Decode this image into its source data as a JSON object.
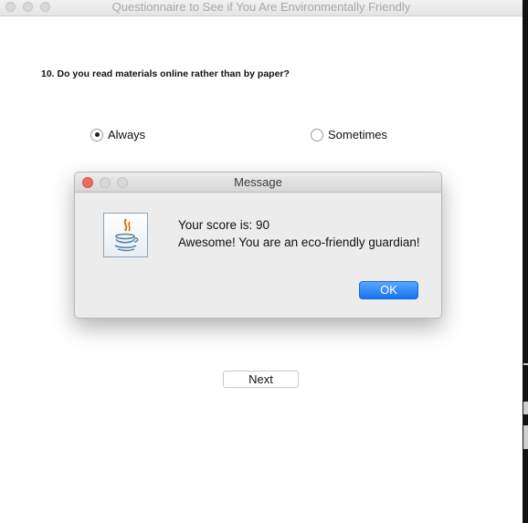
{
  "window": {
    "title": "Questionnaire to See if You Are Environmentally Friendly"
  },
  "question": {
    "text": "10. Do you read materials online rather than by paper?"
  },
  "options": [
    {
      "label": "Always",
      "selected": true
    },
    {
      "label": "Sometimes",
      "selected": false
    }
  ],
  "buttons": {
    "next_label": "Next"
  },
  "dialog": {
    "title": "Message",
    "line1": "Your score is: 90",
    "line2": "Awesome! You are an eco-friendly guardian!",
    "ok_label": "OK",
    "icon": "java-coffee-cup-icon"
  },
  "colors": {
    "close_red": "#ed6a5e",
    "ok_blue": "#1673f0"
  }
}
